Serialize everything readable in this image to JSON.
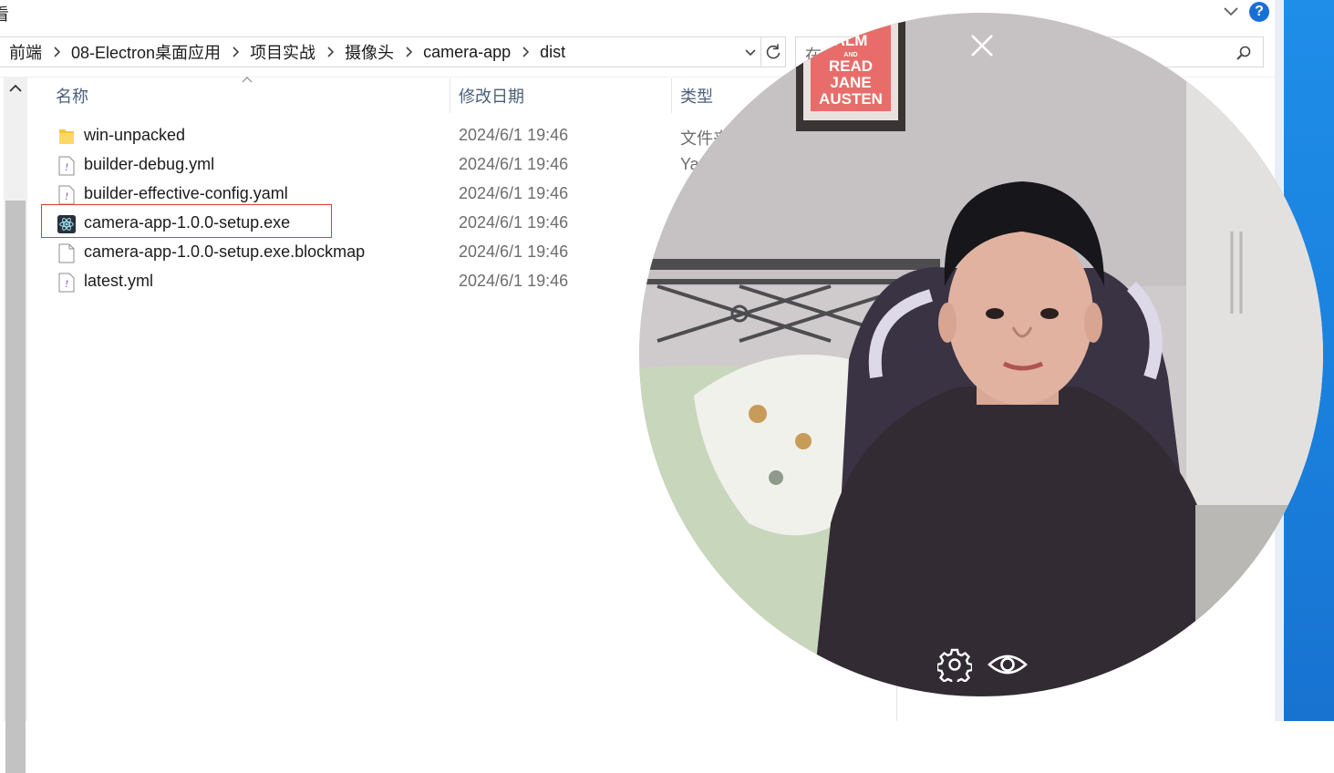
{
  "toolbar": {
    "view_label": "看"
  },
  "address": {
    "crumbs": [
      "前端",
      "08-Electron桌面应用",
      "项目实战",
      "摄像头",
      "camera-app",
      "dist"
    ]
  },
  "search": {
    "placeholder": "在"
  },
  "columns": {
    "name": "名称",
    "modified": "修改日期",
    "type": "类型"
  },
  "files": [
    {
      "name": "win-unpacked",
      "date": "2024/6/1 19:46",
      "type": "文件夹",
      "icon": "folder-icon"
    },
    {
      "name": "builder-debug.yml",
      "date": "2024/6/1 19:46",
      "type": "Ya",
      "icon": "yaml-file-icon"
    },
    {
      "name": "builder-effective-config.yaml",
      "date": "2024/6/1 19:46",
      "type": "",
      "icon": "yaml-file-icon"
    },
    {
      "name": "camera-app-1.0.0-setup.exe",
      "date": "2024/6/1 19:46",
      "type": "",
      "icon": "electron-app-icon",
      "highlighted": true
    },
    {
      "name": "camera-app-1.0.0-setup.exe.blockmap",
      "date": "2024/6/1 19:46",
      "type": "",
      "icon": "blank-file-icon"
    },
    {
      "name": "latest.yml",
      "date": "2024/6/1 19:46",
      "type": "",
      "icon": "yaml-file-icon"
    }
  ],
  "camera": {
    "poster_lines": [
      "ALM",
      "AND",
      "READ",
      "JANE",
      "AUSTEN"
    ],
    "controls": [
      "close-icon",
      "gear-icon",
      "eye-icon"
    ]
  },
  "colors": {
    "highlight_border": "#e23b3b",
    "desktop_blue": "#1a7fdc",
    "header_text": "#4c607a"
  }
}
